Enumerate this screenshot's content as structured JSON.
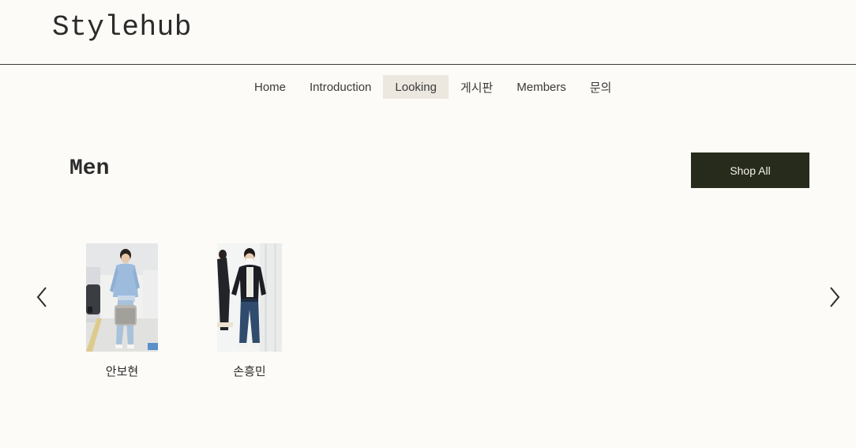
{
  "site": {
    "title": "Stylehub"
  },
  "nav": {
    "items": [
      {
        "label": "Home"
      },
      {
        "label": "Introduction"
      },
      {
        "label": "Looking",
        "active": true
      },
      {
        "label": "게시판"
      },
      {
        "label": "Members"
      },
      {
        "label": "문의"
      }
    ]
  },
  "section": {
    "title": "Men",
    "shop_all_label": "Shop All"
  },
  "products": [
    {
      "name": "안보현"
    },
    {
      "name": "손흥민"
    }
  ],
  "carousel": {
    "prev_icon": "chevron-left-icon",
    "next_icon": "chevron-right-icon"
  },
  "colors": {
    "background": "#fcfbf7",
    "active_nav_bg": "#ece8e0",
    "button_bg": "#262b1c",
    "button_text": "#f4f2ec"
  }
}
